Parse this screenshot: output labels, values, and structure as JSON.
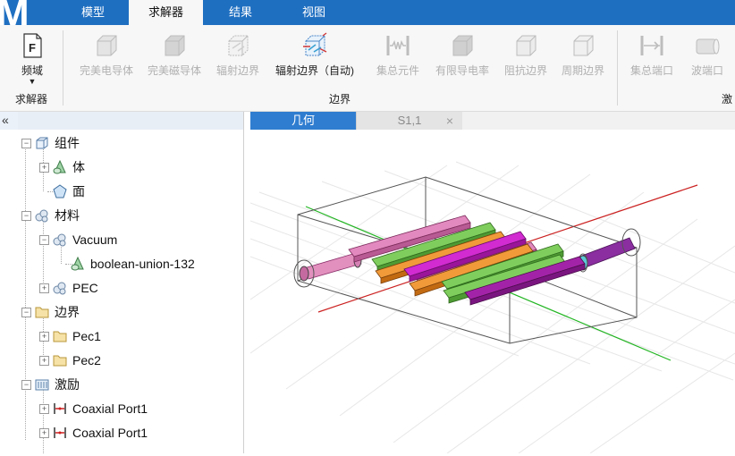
{
  "app": {
    "logo_letter": "M"
  },
  "menu": {
    "tabs": [
      "模型",
      "求解器",
      "结果",
      "视图"
    ],
    "active_index": 1
  },
  "ribbon": {
    "freq_button": {
      "icon_letter": "F",
      "label": "频域",
      "arrow": "▼"
    },
    "solver_group_label": "求解器",
    "boundary_buttons": [
      {
        "label": "完美电导体",
        "enabled": false
      },
      {
        "label": "完美磁导体",
        "enabled": false
      },
      {
        "label": "辐射边界",
        "enabled": false
      },
      {
        "label": "辐射边界（自动)",
        "enabled": true
      },
      {
        "label": "集总元件",
        "enabled": false
      },
      {
        "label": "有限导电率",
        "enabled": false
      },
      {
        "label": "阻抗边界",
        "enabled": false
      },
      {
        "label": "周期边界",
        "enabled": false
      }
    ],
    "boundary_group_label": "边界",
    "excitation_buttons": [
      {
        "label": "集总端口",
        "enabled": false
      },
      {
        "label": "波端口",
        "enabled": false
      }
    ],
    "excitation_group_label_partial": "激"
  },
  "tree": {
    "collapse_glyph": "«",
    "items": [
      {
        "label": "组件",
        "icon": "component-icon",
        "level": 0,
        "toggle": "minus"
      },
      {
        "label": "体",
        "icon": "solid-body-icon",
        "level": 1,
        "toggle": "plus"
      },
      {
        "label": "面",
        "icon": "face-icon",
        "level": 1,
        "toggle": "none"
      },
      {
        "label": "材料",
        "icon": "material-icon",
        "level": 0,
        "toggle": "minus"
      },
      {
        "label": "Vacuum",
        "icon": "material-icon",
        "level": 1,
        "toggle": "minus"
      },
      {
        "label": "boolean-union-132",
        "icon": "solid-body-icon",
        "level": 2,
        "toggle": "none"
      },
      {
        "label": "PEC",
        "icon": "material-icon",
        "level": 1,
        "toggle": "plus"
      },
      {
        "label": "边界",
        "icon": "folder-icon",
        "level": 0,
        "toggle": "minus"
      },
      {
        "label": "Pec1",
        "icon": "folder-icon",
        "level": 1,
        "toggle": "plus"
      },
      {
        "label": "Pec2",
        "icon": "folder-icon",
        "level": 1,
        "toggle": "plus"
      },
      {
        "label": "激励",
        "icon": "excitation-icon",
        "level": 0,
        "toggle": "minus"
      },
      {
        "label": "Coaxial Port1",
        "icon": "port-icon",
        "level": 1,
        "toggle": "plus"
      },
      {
        "label": "Coaxial Port1",
        "icon": "port-icon",
        "level": 1,
        "toggle": "plus"
      }
    ]
  },
  "view_tabs": [
    {
      "label": "几何",
      "active": true
    },
    {
      "label": "S1,1",
      "active": false,
      "close": "×"
    }
  ],
  "colors": {
    "menu_bar": "#1f6fc1",
    "active_view_tab": "#2f7dd0",
    "bar_green": "#6cc04a",
    "bar_pink": "#d9699f",
    "bar_orange": "#e8821a",
    "bar_magenta": "#c31bc3",
    "bar_purple": "#7a1a8c",
    "axis_red": "#cc2222",
    "axis_green": "#22b522"
  }
}
